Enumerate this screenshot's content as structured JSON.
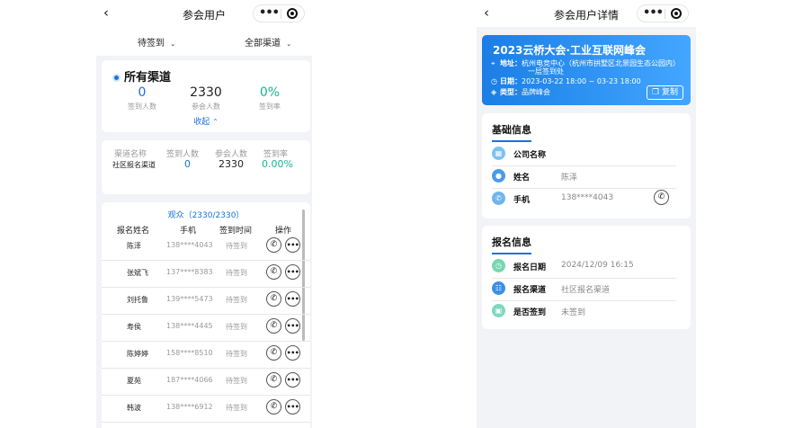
{
  "left": {
    "title": "参会用户",
    "filters": [
      "待签到",
      "全部渠道"
    ],
    "summary": {
      "title": "所有渠道",
      "stats": [
        {
          "value": "0",
          "label": "签到人数"
        },
        {
          "value": "2330",
          "label": "参会人数"
        },
        {
          "value": "0%",
          "label": "签到率"
        }
      ],
      "collapse": "收起"
    },
    "channels": {
      "headers": [
        "渠道名称",
        "签到人数",
        "参会人数",
        "签到率"
      ],
      "row": [
        "社区报名渠道",
        "0",
        "2330",
        "0.00%"
      ]
    },
    "audience": {
      "title": "观众（2330/2330）",
      "headers": [
        "报名姓名",
        "手机",
        "签到时间",
        "操作"
      ],
      "rows": [
        {
          "name": "陈泽",
          "phone": "138****4043",
          "status": "待签到"
        },
        {
          "name": "张斌飞",
          "phone": "137****8383",
          "status": "待签到"
        },
        {
          "name": "刘托鲁",
          "phone": "139****5473",
          "status": "待签到"
        },
        {
          "name": "寿侯",
          "phone": "138****4445",
          "status": "待签到"
        },
        {
          "name": "陈婷婷",
          "phone": "158****8510",
          "status": "待签到"
        },
        {
          "name": "夏苑",
          "phone": "187****4066",
          "status": "待签到"
        },
        {
          "name": "韩波",
          "phone": "138****6912",
          "status": "待签到"
        }
      ]
    }
  },
  "right": {
    "title": "参会用户详情",
    "event": {
      "title": "2023云桥大会·工业互联网峰会",
      "address_label": "地址：",
      "address_line1": "杭州电竞中心（杭州市拱墅区北景园生态公园内）",
      "address_line2": "一层签到处",
      "date_label": "日期：",
      "date": "2023-03-22 18:00 ~ 03-23 18:00",
      "type_label": "类型：",
      "type": "品牌峰会",
      "copy": "复制"
    },
    "basic": {
      "title": "基础信息",
      "rows": [
        {
          "key": "公司名称",
          "value": ""
        },
        {
          "key": "姓名",
          "value": "陈泽"
        },
        {
          "key": "手机",
          "value": "138****4043"
        }
      ]
    },
    "signup": {
      "title": "报名信息",
      "rows": [
        {
          "key": "报名日期",
          "value": "2024/12/09 16:15"
        },
        {
          "key": "报名渠道",
          "value": "社区报名渠道"
        },
        {
          "key": "是否签到",
          "value": "未签到"
        }
      ]
    }
  },
  "colors": {
    "accent": "#1a73d9",
    "green": "#19b393",
    "background": "#f2f3f7"
  },
  "icons": {
    "back": "chevron-left-icon",
    "more": "more-dots-icon",
    "record": "record-icon",
    "dropdown": "chevron-down-icon",
    "call": "phone-icon",
    "location": "location-pin-icon",
    "clock": "clock-icon",
    "tag": "tag-icon",
    "copy": "copy-icon"
  }
}
